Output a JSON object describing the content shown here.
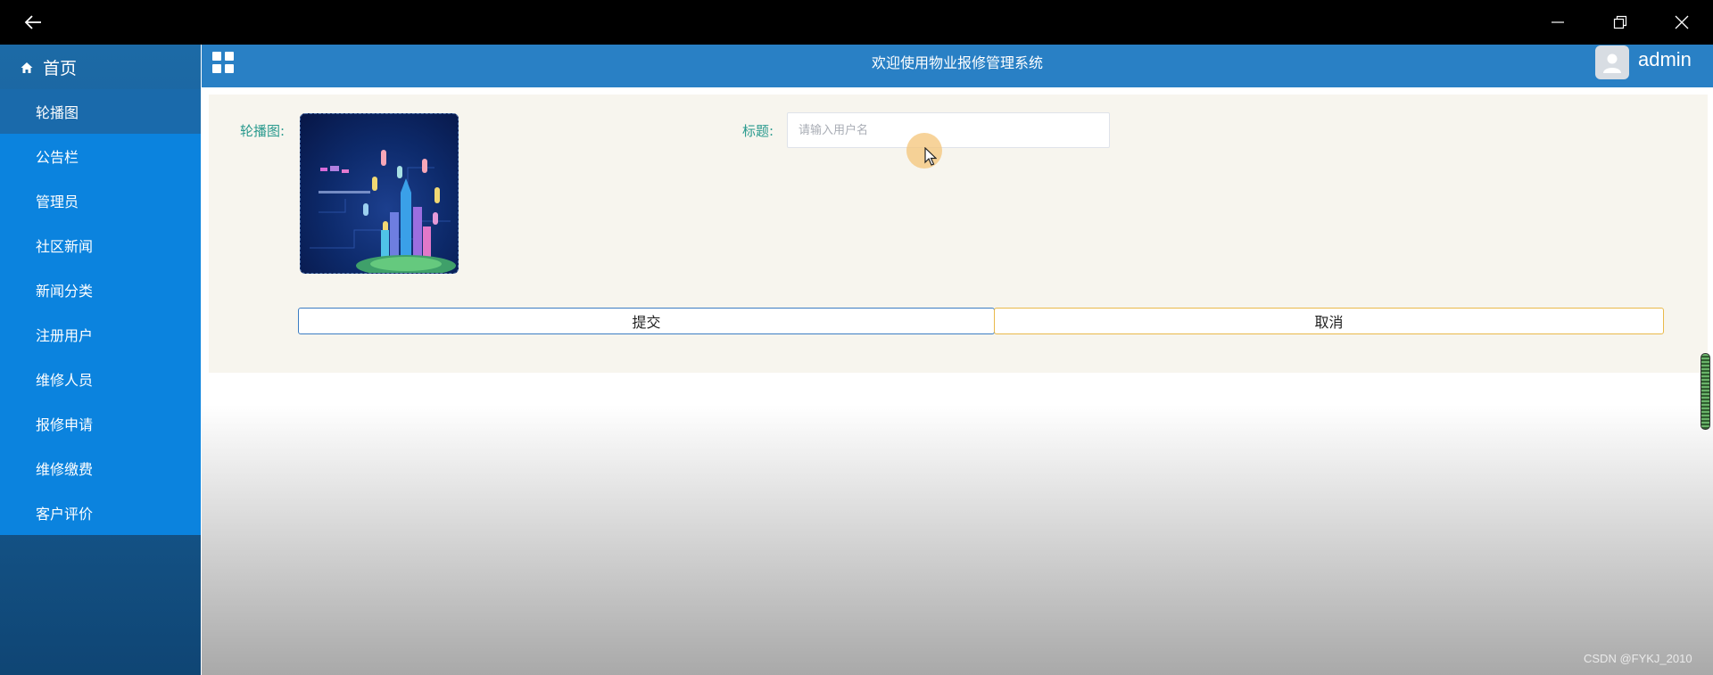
{
  "header": {
    "title": "欢迎使用物业报修管理系统",
    "username": "admin"
  },
  "sidebar": {
    "home_label": "首页",
    "items": [
      {
        "label": "轮播图",
        "active": true
      },
      {
        "label": "公告栏"
      },
      {
        "label": "管理员"
      },
      {
        "label": "社区新闻"
      },
      {
        "label": "新闻分类"
      },
      {
        "label": "注册用户"
      },
      {
        "label": "维修人员"
      },
      {
        "label": "报修申请"
      },
      {
        "label": "维修缴费"
      },
      {
        "label": "客户评价"
      }
    ]
  },
  "form": {
    "carousel_label": "轮播图:",
    "title_label": "标题:",
    "title_value": "",
    "title_placeholder": "请输入用户名",
    "submit_label": "提交",
    "cancel_label": "取消"
  },
  "watermark": "CSDN @FYKJ_2010",
  "colors": {
    "sidebar_blue": "#0b83de",
    "header_blue": "#2980c5",
    "label_teal": "#2a9a8e",
    "submit_border": "#3b7cc2",
    "cancel_border": "#e9b94a"
  },
  "icons": [
    "back-arrow-icon",
    "minimize-icon",
    "maximize-icon",
    "close-icon",
    "home-icon",
    "grid-menu-icon",
    "user-avatar-icon",
    "mouse-cursor-icon"
  ]
}
